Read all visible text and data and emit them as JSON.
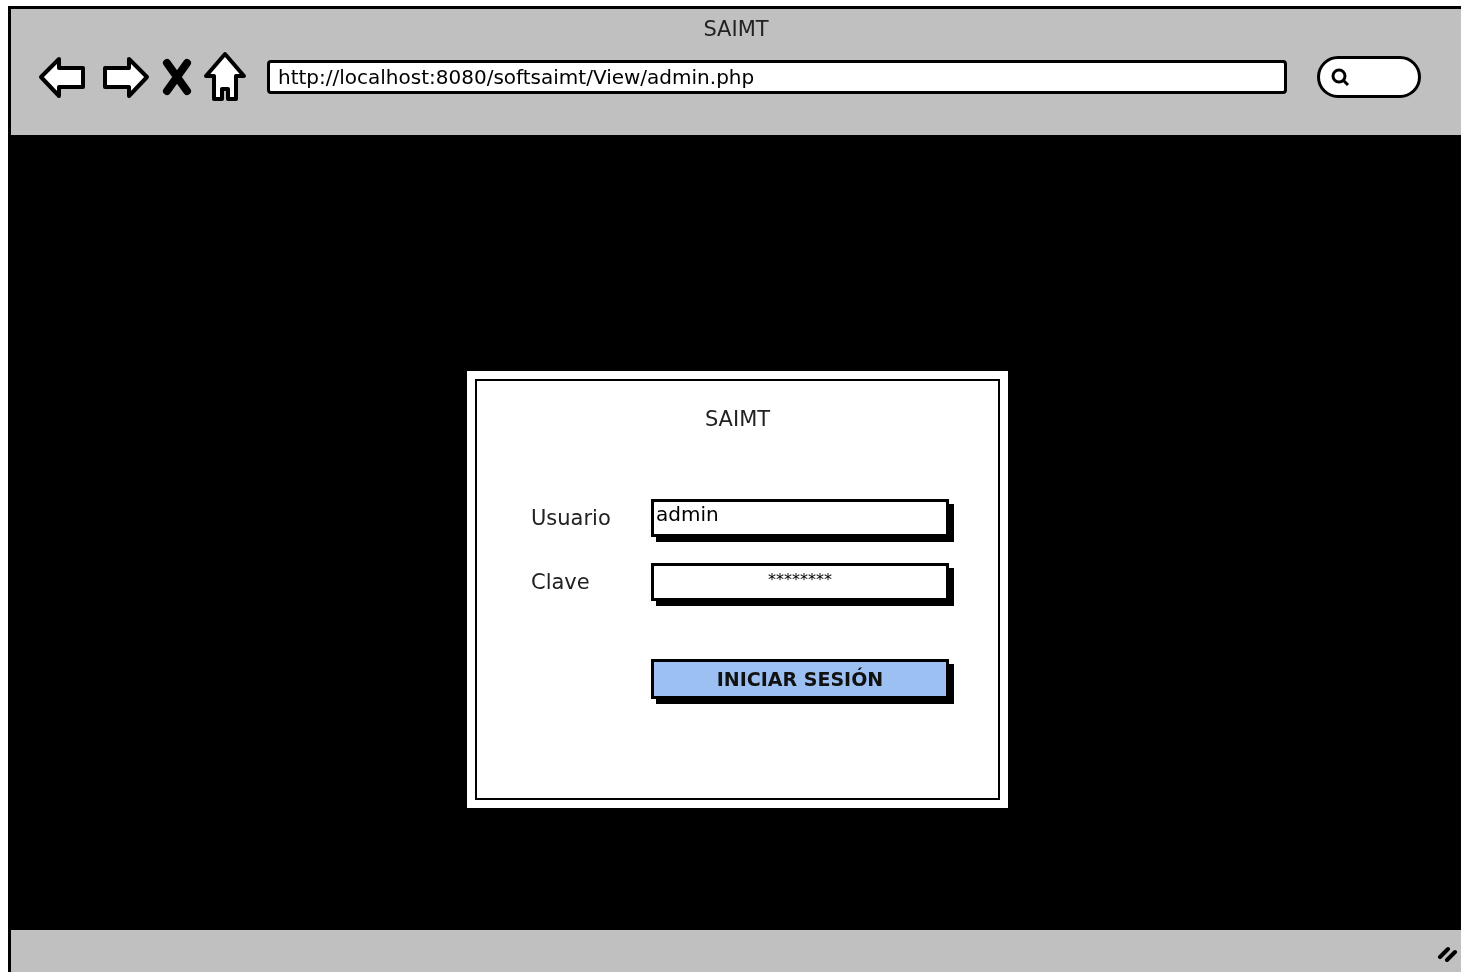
{
  "window": {
    "title": "SAIMT"
  },
  "address_bar": {
    "url": "http://localhost:8080/softsaimt/View/admin.php"
  },
  "dialog": {
    "title": "SAIMT",
    "fields": [
      {
        "label": "Usuario",
        "kind": "text",
        "value": "admin"
      },
      {
        "label": "Clave",
        "kind": "password",
        "value": "********"
      }
    ],
    "button": "INICIAR SESIÓN"
  }
}
